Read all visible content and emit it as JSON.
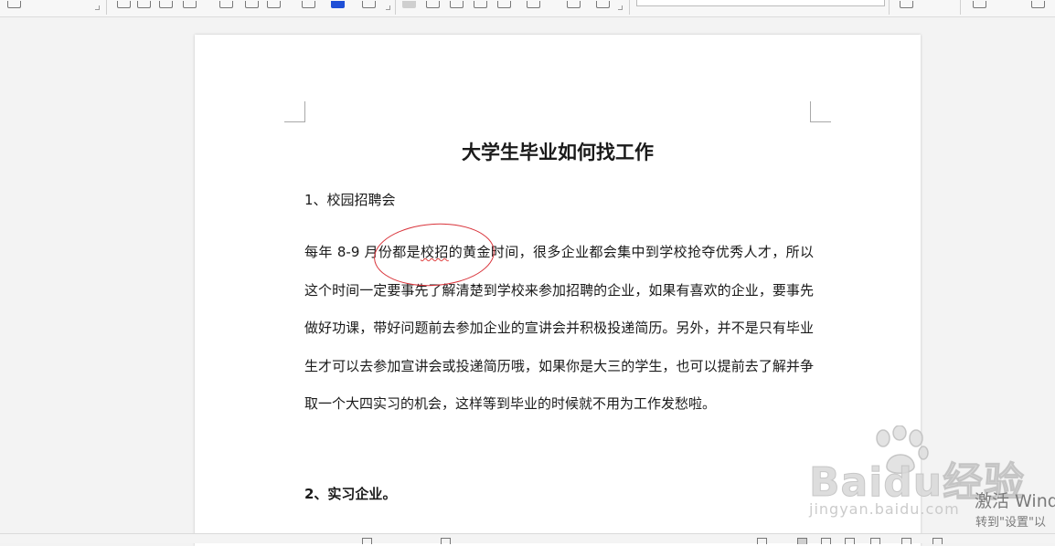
{
  "document": {
    "title": "大学生毕业如何找工作",
    "section1": "1、校园招聘会",
    "paragraph_pre": "每年 8-9 月份都是",
    "paragraph_mark": "校招",
    "paragraph_post": "的黄金时间，很多企业都会集中到学校抢夺优秀人才，所以 这个时间一定要事先了解清楚到学校来参加招聘的企业，如果有喜欢的企业，要事先做好功课，带好问题前去参加企业的宣讲会并积极投递简历。另外，并不是只有毕业生才可以去参加宣讲会或投递简历哦，如果你是大三的学生，也可以提前去了解并争取一个大四实习的机会，这样等到毕业的时候就不用为工作发愁啦。",
    "section2": "2、实习企业。"
  },
  "watermarks": {
    "baidu_logo": "Baidu经验",
    "baidu_url": "jingyan.baidu.com",
    "activate_line1": "激活 Wind",
    "activate_line2": "转到\"设置\"以"
  },
  "colors": {
    "annotation": "#d9343b",
    "font_color_swatch": "#1f4fd6",
    "spellcheck": "#e04040"
  },
  "icons": {
    "font_color": "font-color-icon",
    "align_left": "align-left-icon",
    "paw": "baidu-paw-icon"
  }
}
